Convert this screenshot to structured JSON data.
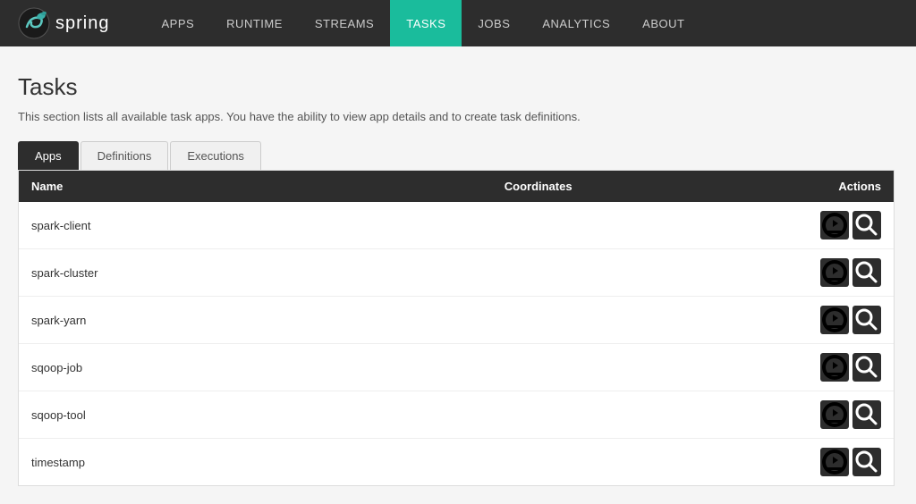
{
  "brand": {
    "name": "spring"
  },
  "nav": {
    "items": [
      {
        "id": "apps",
        "label": "APPS",
        "active": false
      },
      {
        "id": "runtime",
        "label": "RUNTIME",
        "active": false
      },
      {
        "id": "streams",
        "label": "STREAMS",
        "active": false
      },
      {
        "id": "tasks",
        "label": "TASKS",
        "active": true
      },
      {
        "id": "jobs",
        "label": "JOBS",
        "active": false
      },
      {
        "id": "analytics",
        "label": "ANALYTICS",
        "active": false
      },
      {
        "id": "about",
        "label": "ABOUT",
        "active": false
      }
    ]
  },
  "page": {
    "title": "Tasks",
    "description": "This section lists all available task apps. You have the ability to view app details and to create task definitions."
  },
  "tabs": [
    {
      "id": "apps",
      "label": "Apps",
      "active": true
    },
    {
      "id": "definitions",
      "label": "Definitions",
      "active": false
    },
    {
      "id": "executions",
      "label": "Executions",
      "active": false
    }
  ],
  "table": {
    "columns": {
      "name": "Name",
      "coordinates": "Coordinates",
      "actions": "Actions"
    },
    "rows": [
      {
        "name": "spark-client"
      },
      {
        "name": "spark-cluster"
      },
      {
        "name": "spark-yarn"
      },
      {
        "name": "sqoop-job"
      },
      {
        "name": "sqoop-tool"
      },
      {
        "name": "timestamp"
      }
    ]
  }
}
